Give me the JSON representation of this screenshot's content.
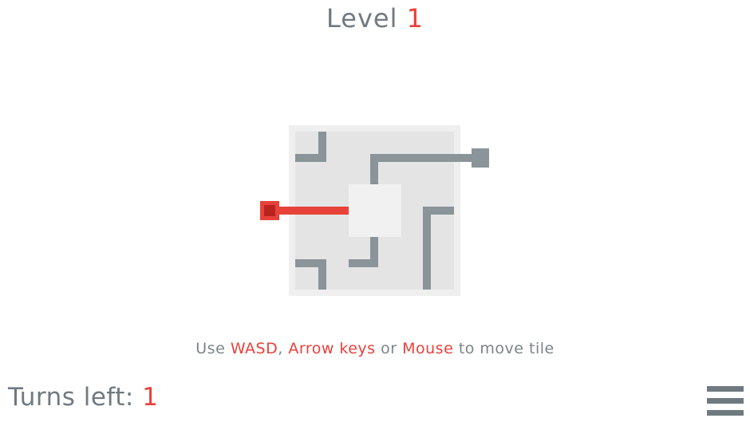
{
  "header": {
    "level_label": "Level",
    "level_number": "1"
  },
  "instructions": {
    "prefix": "Use",
    "key1": "WASD",
    "sep1": ",",
    "key2": "Arrow keys",
    "sep2": "or",
    "key3": "Mouse",
    "suffix": "to move tile"
  },
  "footer": {
    "turns_label": "Turns left:",
    "turns_value": "1",
    "menu_icon": "hamburger-menu-icon"
  },
  "colors": {
    "accent": "#e8413a",
    "pipe": "#8a9499",
    "board": "#e4e4e4",
    "board_border": "#efefef",
    "empty_tile": "#f1f1f1",
    "text": "#6f7a80"
  }
}
